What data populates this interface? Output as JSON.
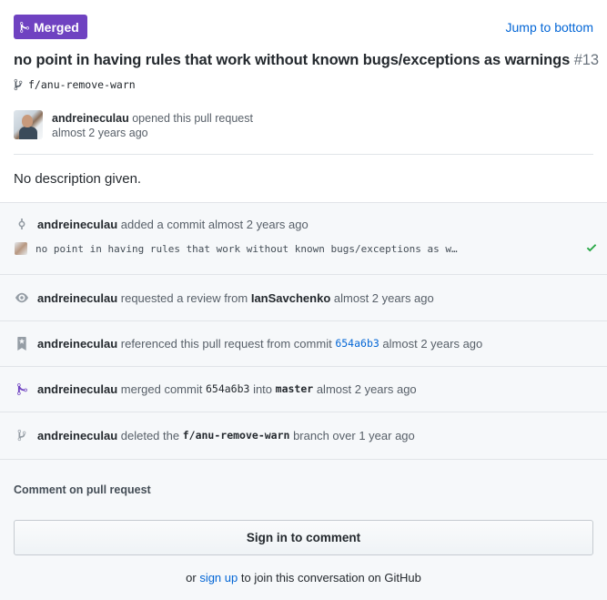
{
  "header": {
    "state_label": "Merged",
    "jump_label": "Jump to bottom",
    "title": "no point in having rules that work without known bugs/exceptions as warnings",
    "number": "#13",
    "branch": "f/anu-remove-warn"
  },
  "opener": {
    "user": "andreineculau",
    "action": "opened this pull request",
    "time": "almost 2 years ago"
  },
  "description": "No description given.",
  "timeline": {
    "commit_event": {
      "user": "andreineculau",
      "action": "added a commit almost 2 years ago",
      "message": "no point in having rules that work without known bugs/exceptions as w…"
    },
    "review_event": {
      "user": "andreineculau",
      "action": "requested a review from",
      "reviewer": "IanSavchenko",
      "time": "almost 2 years ago"
    },
    "reference_event": {
      "user": "andreineculau",
      "action": "referenced this pull request from commit",
      "sha": "654a6b3",
      "time": "almost 2 years ago"
    },
    "merge_event": {
      "user": "andreineculau",
      "action": "merged commit",
      "sha": "654a6b3",
      "into": "into",
      "target": "master",
      "time": "almost 2 years ago"
    },
    "delete_event": {
      "user": "andreineculau",
      "action": "deleted the",
      "branch": "f/anu-remove-warn",
      "suffix": "branch over 1 year ago"
    }
  },
  "comment": {
    "label": "Comment on pull request",
    "signin_label": "Sign in to comment",
    "or_text": "or",
    "signup_label": "sign up",
    "join_text": "to join this conversation on GitHub"
  },
  "colors": {
    "merged": "#6f42c1",
    "link": "#0366d6",
    "success": "#28a745"
  },
  "icons": [
    "merge-icon",
    "branch-icon",
    "commit-icon",
    "eye-icon",
    "bookmark-icon",
    "check-icon"
  ]
}
